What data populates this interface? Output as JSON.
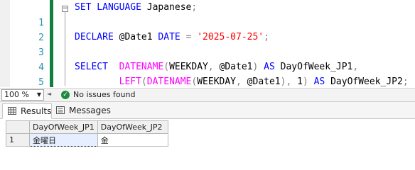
{
  "editor": {
    "lines": [
      {
        "num": "1",
        "tokens": [
          [
            "k",
            "SET LANGUAGE "
          ],
          [
            "v",
            "Japanese"
          ],
          [
            "p",
            ";"
          ]
        ]
      },
      {
        "num": "2",
        "tokens": []
      },
      {
        "num": "3",
        "tokens": [
          [
            "k",
            "DECLARE "
          ],
          [
            "v",
            "@Date1 "
          ],
          [
            "k",
            "DATE "
          ],
          [
            "p",
            "= "
          ],
          [
            "s",
            "'2025-07-25'"
          ],
          [
            "p",
            ";"
          ]
        ]
      },
      {
        "num": "4",
        "tokens": []
      },
      {
        "num": "5",
        "tokens": [
          [
            "k",
            "SELECT  "
          ],
          [
            "f",
            "DATENAME"
          ],
          [
            "p",
            "("
          ],
          [
            "v",
            "WEEKDAY"
          ],
          [
            "p",
            ", "
          ],
          [
            "v",
            "@Date1"
          ],
          [
            "p",
            ") "
          ],
          [
            "k",
            "AS "
          ],
          [
            "v",
            "DayOfWeek_JP1"
          ],
          [
            "p",
            ","
          ]
        ]
      },
      {
        "num": "6",
        "tokens": [
          [
            "v",
            "        "
          ],
          [
            "f",
            "LEFT"
          ],
          [
            "p",
            "("
          ],
          [
            "f",
            "DATENAME"
          ],
          [
            "p",
            "("
          ],
          [
            "v",
            "WEEKDAY"
          ],
          [
            "p",
            ", "
          ],
          [
            "v",
            "@Date1"
          ],
          [
            "p",
            "), "
          ],
          [
            "v",
            "1"
          ],
          [
            "p",
            ") "
          ],
          [
            "k",
            "AS "
          ],
          [
            "v",
            "DayOfWeek_JP2"
          ],
          [
            "p",
            ";"
          ]
        ]
      }
    ]
  },
  "statusbar": {
    "zoom": "100 %",
    "issues": "No issues found"
  },
  "results": {
    "tabs": {
      "results": "Results",
      "messages": "Messages"
    },
    "columns": [
      "DayOfWeek_JP1",
      "DayOfWeek_JP2"
    ],
    "rows": [
      {
        "num": "1",
        "cells": [
          "金曜日",
          "金"
        ]
      }
    ]
  },
  "colors": {
    "keyword": "#0000ff",
    "function": "#ff00ff",
    "string": "#ff0000",
    "punct": "#808080",
    "line_number": "#2b91af",
    "change_bar": "#108040",
    "ok": "#1e8a3c"
  }
}
